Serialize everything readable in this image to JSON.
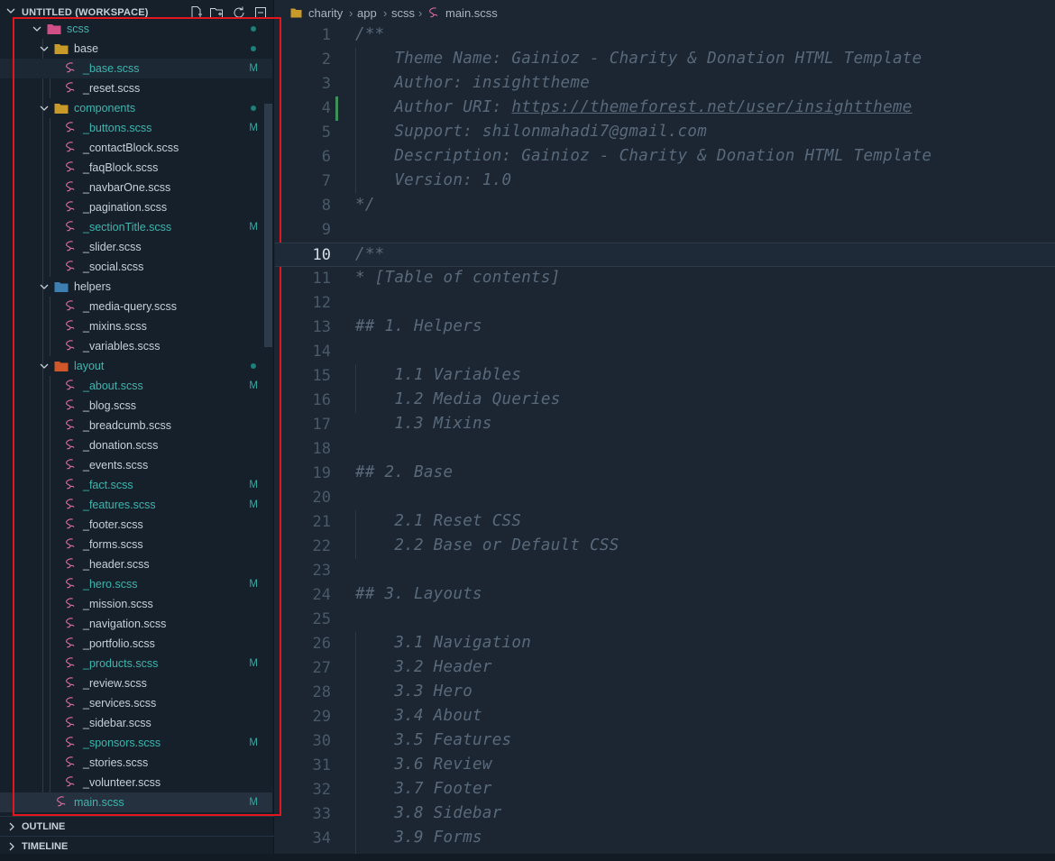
{
  "sidebar": {
    "workspace_title": "UNTITLED (WORKSPACE)",
    "tree": [
      {
        "label": "scss",
        "type": "folder",
        "status": "dot",
        "modified": true
      },
      {
        "label": "base",
        "type": "folder",
        "status": "dot",
        "modified": false
      },
      {
        "label": "_base.scss",
        "type": "file",
        "status": "M",
        "modified": true
      },
      {
        "label": "_reset.scss",
        "type": "file",
        "status": "",
        "modified": false
      },
      {
        "label": "components",
        "type": "folder",
        "status": "dot",
        "modified": true
      },
      {
        "label": "_buttons.scss",
        "type": "file",
        "status": "M",
        "modified": true
      },
      {
        "label": "_contactBlock.scss",
        "type": "file",
        "status": "",
        "modified": false
      },
      {
        "label": "_faqBlock.scss",
        "type": "file",
        "status": "",
        "modified": false
      },
      {
        "label": "_navbarOne.scss",
        "type": "file",
        "status": "",
        "modified": false
      },
      {
        "label": "_pagination.scss",
        "type": "file",
        "status": "",
        "modified": false
      },
      {
        "label": "_sectionTitle.scss",
        "type": "file",
        "status": "M",
        "modified": true
      },
      {
        "label": "_slider.scss",
        "type": "file",
        "status": "",
        "modified": false
      },
      {
        "label": "_social.scss",
        "type": "file",
        "status": "",
        "modified": false
      },
      {
        "label": "helpers",
        "type": "folder",
        "status": "",
        "modified": false
      },
      {
        "label": "_media-query.scss",
        "type": "file",
        "status": "",
        "modified": false
      },
      {
        "label": "_mixins.scss",
        "type": "file",
        "status": "",
        "modified": false
      },
      {
        "label": "_variables.scss",
        "type": "file",
        "status": "",
        "modified": false
      },
      {
        "label": "layout",
        "type": "folder",
        "status": "dot",
        "modified": true
      },
      {
        "label": "_about.scss",
        "type": "file",
        "status": "M",
        "modified": true
      },
      {
        "label": "_blog.scss",
        "type": "file",
        "status": "",
        "modified": false
      },
      {
        "label": "_breadcumb.scss",
        "type": "file",
        "status": "",
        "modified": false
      },
      {
        "label": "_donation.scss",
        "type": "file",
        "status": "",
        "modified": false
      },
      {
        "label": "_events.scss",
        "type": "file",
        "status": "",
        "modified": false
      },
      {
        "label": "_fact.scss",
        "type": "file",
        "status": "M",
        "modified": true
      },
      {
        "label": "_features.scss",
        "type": "file",
        "status": "M",
        "modified": true
      },
      {
        "label": "_footer.scss",
        "type": "file",
        "status": "",
        "modified": false
      },
      {
        "label": "_forms.scss",
        "type": "file",
        "status": "",
        "modified": false
      },
      {
        "label": "_header.scss",
        "type": "file",
        "status": "",
        "modified": false
      },
      {
        "label": "_hero.scss",
        "type": "file",
        "status": "M",
        "modified": true
      },
      {
        "label": "_mission.scss",
        "type": "file",
        "status": "",
        "modified": false
      },
      {
        "label": "_navigation.scss",
        "type": "file",
        "status": "",
        "modified": false
      },
      {
        "label": "_portfolio.scss",
        "type": "file",
        "status": "",
        "modified": false
      },
      {
        "label": "_products.scss",
        "type": "file",
        "status": "M",
        "modified": true
      },
      {
        "label": "_review.scss",
        "type": "file",
        "status": "",
        "modified": false
      },
      {
        "label": "_services.scss",
        "type": "file",
        "status": "",
        "modified": false
      },
      {
        "label": "_sidebar.scss",
        "type": "file",
        "status": "",
        "modified": false
      },
      {
        "label": "_sponsors.scss",
        "type": "file",
        "status": "M",
        "modified": true
      },
      {
        "label": "_stories.scss",
        "type": "file",
        "status": "",
        "modified": false
      },
      {
        "label": "_volunteer.scss",
        "type": "file",
        "status": "",
        "modified": false
      },
      {
        "label": "main.scss",
        "type": "file",
        "status": "M",
        "modified": true
      }
    ],
    "outline_label": "OUTLINE",
    "timeline_label": "TIMELINE"
  },
  "breadcrumbs": [
    "charity",
    "app",
    "scss",
    "main.scss"
  ],
  "editor": {
    "current_line": 10,
    "lines": [
      {
        "n": "1",
        "text": "/**"
      },
      {
        "n": "2",
        "text": "    Theme Name: Gainioz - Charity & Donation HTML Template"
      },
      {
        "n": "3",
        "text": "    Author: insighttheme"
      },
      {
        "n": "4",
        "text": "    Author URI: https://themeforest.net/user/insighttheme"
      },
      {
        "n": "5",
        "text": "    Support: shilonmahadi7@gmail.com"
      },
      {
        "n": "6",
        "text": "    Description: Gainioz - Charity & Donation HTML Template"
      },
      {
        "n": "7",
        "text": "    Version: 1.0"
      },
      {
        "n": "8",
        "text": "*/"
      },
      {
        "n": "9",
        "text": ""
      },
      {
        "n": "10",
        "text": "/**"
      },
      {
        "n": "11",
        "text": "* [Table of contents]"
      },
      {
        "n": "12",
        "text": ""
      },
      {
        "n": "13",
        "text": "## 1. Helpers"
      },
      {
        "n": "14",
        "text": ""
      },
      {
        "n": "15",
        "text": "    1.1 Variables"
      },
      {
        "n": "16",
        "text": "    1.2 Media Queries"
      },
      {
        "n": "17",
        "text": "    1.3 Mixins"
      },
      {
        "n": "18",
        "text": ""
      },
      {
        "n": "19",
        "text": "## 2. Base"
      },
      {
        "n": "20",
        "text": ""
      },
      {
        "n": "21",
        "text": "    2.1 Reset CSS"
      },
      {
        "n": "22",
        "text": "    2.2 Base or Default CSS"
      },
      {
        "n": "23",
        "text": ""
      },
      {
        "n": "24",
        "text": "## 3. Layouts"
      },
      {
        "n": "25",
        "text": ""
      },
      {
        "n": "26",
        "text": "    3.1 Navigation"
      },
      {
        "n": "27",
        "text": "    3.2 Header"
      },
      {
        "n": "28",
        "text": "    3.3 Hero"
      },
      {
        "n": "29",
        "text": "    3.4 About"
      },
      {
        "n": "30",
        "text": "    3.5 Features"
      },
      {
        "n": "31",
        "text": "    3.6 Review"
      },
      {
        "n": "32",
        "text": "    3.7 Footer"
      },
      {
        "n": "33",
        "text": "    3.8 Sidebar"
      },
      {
        "n": "34",
        "text": "    3.9 Forms"
      }
    ]
  },
  "colors": {
    "modified": "#3fb5ae",
    "highlight_box": "#e3161d",
    "comment": "#59697a"
  }
}
